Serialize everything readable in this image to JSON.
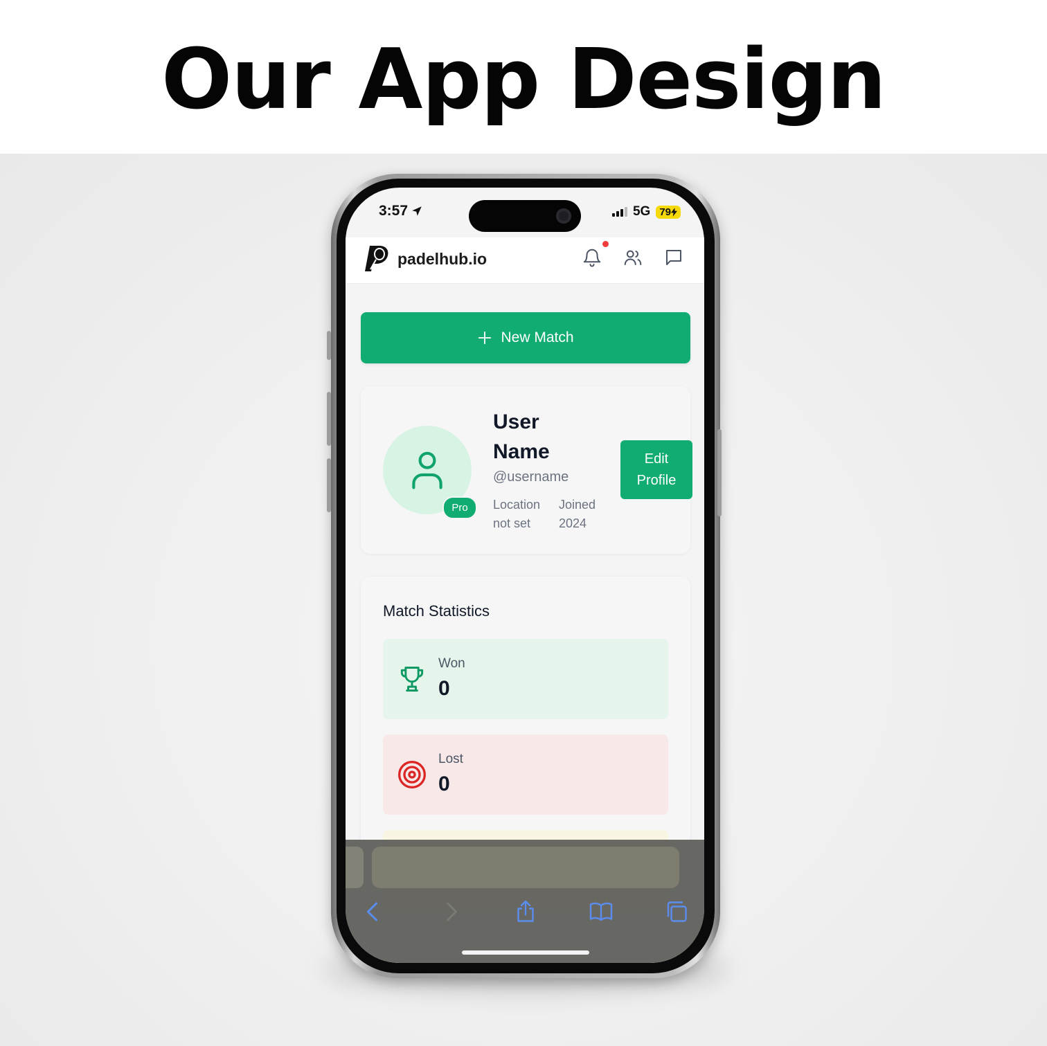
{
  "headline": "Our App Design",
  "status_bar": {
    "time": "3:57",
    "network": "5G",
    "battery": "79"
  },
  "app": {
    "brand": "padelhub.io",
    "new_match_label": "New Match"
  },
  "profile": {
    "name": "User Name",
    "handle": "@username",
    "location": "Location not set",
    "joined": "Joined 2024",
    "badge": "Pro",
    "edit_label": "Edit Profile"
  },
  "stats": {
    "title": "Match Statistics",
    "items": [
      {
        "label": "Won",
        "value": "0",
        "icon": "trophy-icon"
      },
      {
        "label": "Lost",
        "value": "0",
        "icon": "target-icon"
      }
    ]
  },
  "colors": {
    "accent": "#10ac72",
    "won_bg": "#e6f5ec",
    "lost_bg": "#f8e8e8",
    "danger": "#dc2626",
    "battery": "#f5d90a",
    "browser_blue": "#3b82f6"
  }
}
